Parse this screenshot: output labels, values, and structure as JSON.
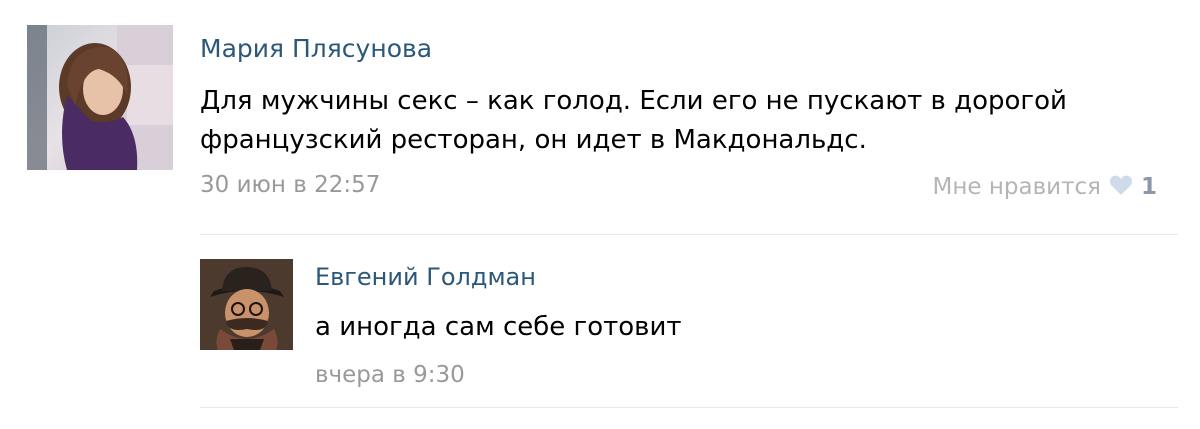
{
  "post": {
    "author": "Мария Плясунова",
    "text": "Для мужчины секс – как голод. Если его не пускают в дорогой французский ресторан, он идет в Макдональдс.",
    "date": "30 июн в 22:57",
    "like_label": "Мне нравится",
    "like_count": "1",
    "like_icon": "heart-icon"
  },
  "reply": {
    "author": "Евгений Голдман",
    "text": "а иногда сам себе готовит",
    "date": "вчера в 9:30"
  },
  "colors": {
    "author_link": "#2b587a",
    "meta_text": "#999999",
    "like_heart": "#cfdbe8",
    "divider": "#e6e9ed"
  }
}
